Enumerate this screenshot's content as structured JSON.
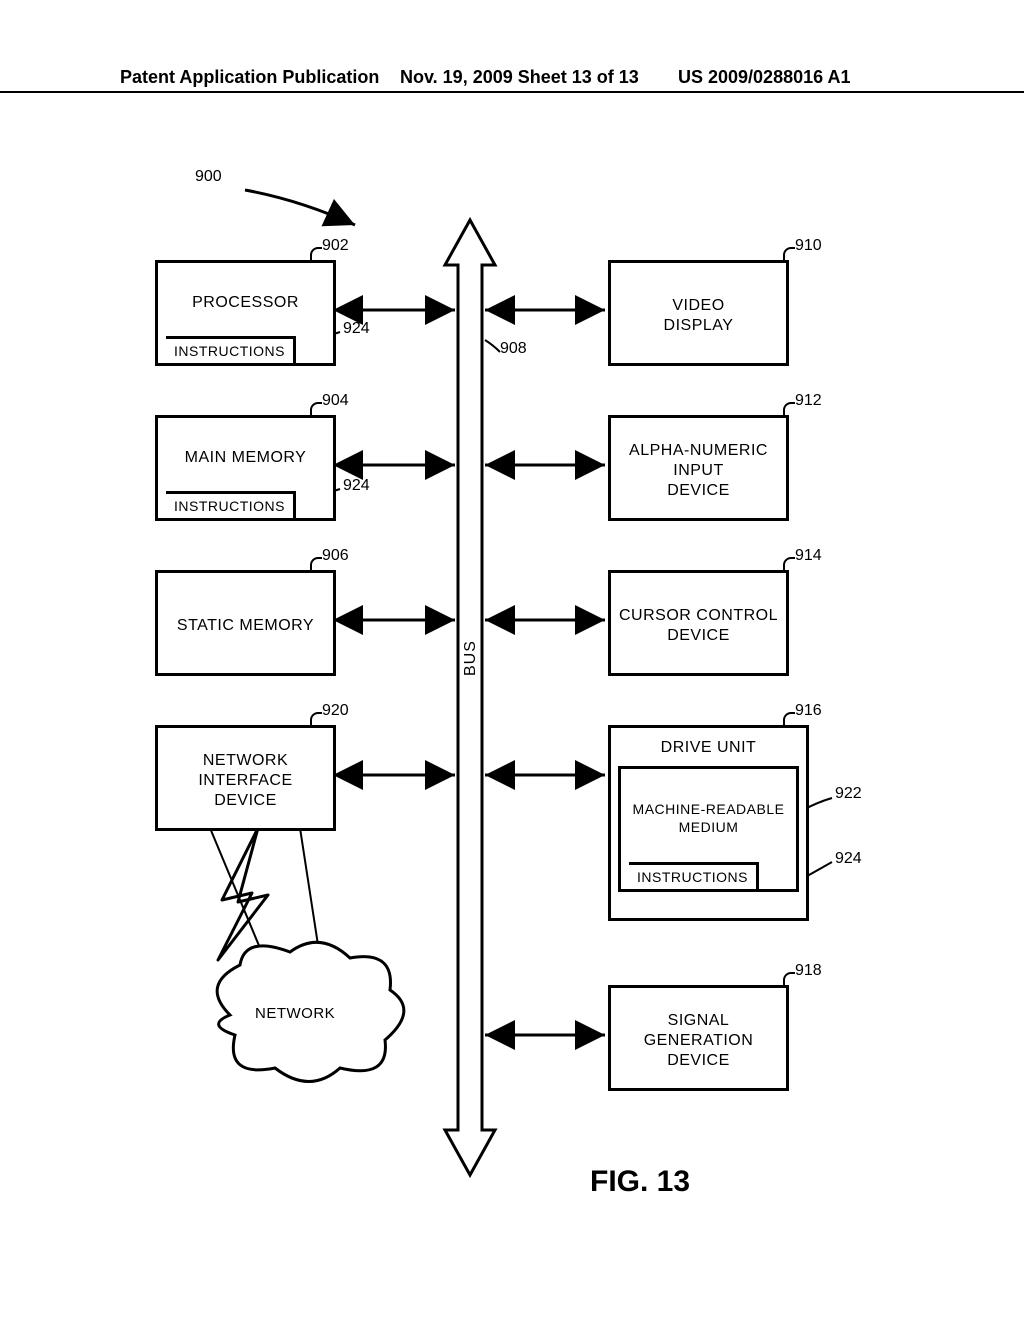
{
  "header": {
    "left": "Patent Application Publication",
    "middle": "Nov. 19, 2009  Sheet 13 of 13",
    "right": "US 2009/0288016 A1"
  },
  "refs": {
    "r900": "900",
    "r902": "902",
    "r904": "904",
    "r906": "906",
    "r908": "908",
    "r910": "910",
    "r912": "912",
    "r914": "914",
    "r916": "916",
    "r918": "918",
    "r920": "920",
    "r922": "922",
    "r924a": "924",
    "r924b": "924",
    "r924c": "924"
  },
  "bus_label": "BUS",
  "boxes": {
    "processor": "PROCESSOR",
    "main_memory": "MAIN MEMORY",
    "static_memory": "STATIC MEMORY",
    "network_interface": "NETWORK\nINTERFACE\nDEVICE",
    "video_display": "VIDEO\nDISPLAY",
    "alpha_input": "ALPHA-NUMERIC\nINPUT\nDEVICE",
    "cursor": "CURSOR CONTROL\nDEVICE",
    "drive_unit": "DRIVE UNIT",
    "mr_medium": "MACHINE-READABLE\nMEDIUM",
    "signal_gen": "SIGNAL\nGENERATION\nDEVICE",
    "instructions": "INSTRUCTIONS",
    "network": "NETWORK"
  },
  "figure_caption": "FIG. 13"
}
